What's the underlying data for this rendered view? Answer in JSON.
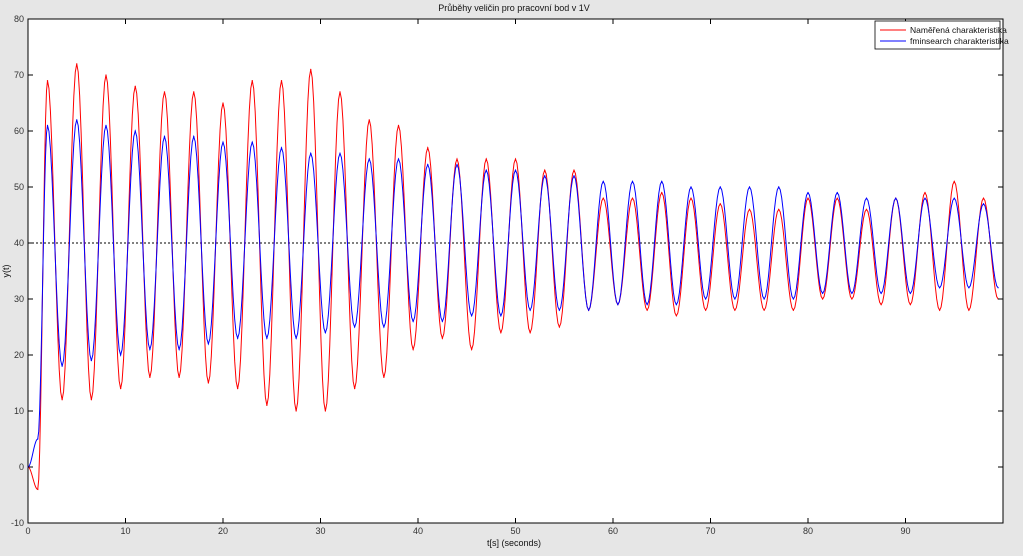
{
  "chart_data": {
    "type": "line",
    "title": "Průběhy veličin pro pracovní bod v 1V",
    "xlabel": "t[s] (seconds)",
    "ylabel": "y(t)",
    "xlim": [
      0,
      100
    ],
    "ylim": [
      -10,
      80
    ],
    "xticks": [
      0,
      10,
      20,
      30,
      40,
      50,
      60,
      70,
      80,
      90
    ],
    "yticks": [
      -10,
      0,
      10,
      20,
      30,
      40,
      50,
      60,
      70,
      80
    ],
    "grid": false,
    "legend_position": "top-right",
    "reference_line": {
      "y": 40,
      "style": "dotted",
      "color": "#000000"
    },
    "series": [
      {
        "name": "Naměřená charakteristika",
        "color": "#ff0000",
        "x": [
          0,
          1,
          2,
          3.5,
          5,
          6.5,
          8,
          9.5,
          11,
          12.5,
          14,
          15.5,
          17,
          18.5,
          20,
          21.5,
          23,
          24.5,
          26,
          27.5,
          29,
          30.5,
          32,
          33.5,
          35,
          36.5,
          38,
          39.5,
          41,
          42.5,
          44,
          45.5,
          47,
          48.5,
          50,
          51.5,
          53,
          54.5,
          56,
          57.5,
          59,
          60.5,
          62,
          63.5,
          65,
          66.5,
          68,
          69.5,
          71,
          72.5,
          74,
          75.5,
          77,
          78.5,
          80,
          81.5,
          83,
          84.5,
          86,
          87.5,
          89,
          90.5,
          92,
          93.5,
          95,
          96.5,
          98,
          99.5
        ],
        "y": [
          0,
          -4,
          69,
          12,
          72,
          12,
          70,
          14,
          68,
          16,
          67,
          16,
          67,
          15,
          65,
          14,
          69,
          11,
          69,
          10,
          71,
          10,
          67,
          14,
          62,
          16,
          61,
          21,
          57,
          23,
          55,
          21,
          55,
          24,
          55,
          24,
          53,
          25,
          53,
          28,
          48,
          29,
          48,
          28,
          49,
          27,
          48,
          28,
          47,
          28,
          46,
          28,
          46,
          28,
          48,
          30,
          48,
          30,
          46,
          29,
          48,
          29,
          49,
          28,
          51,
          28,
          48,
          30
        ]
      },
      {
        "name": "fminsearch charakteristika",
        "color": "#0000ff",
        "x": [
          0,
          1,
          2,
          3.5,
          5,
          6.5,
          8,
          9.5,
          11,
          12.5,
          14,
          15.5,
          17,
          18.5,
          20,
          21.5,
          23,
          24.5,
          26,
          27.5,
          29,
          30.5,
          32,
          33.5,
          35,
          36.5,
          38,
          39.5,
          41,
          42.5,
          44,
          45.5,
          47,
          48.5,
          50,
          51.5,
          53,
          54.5,
          56,
          57.5,
          59,
          60.5,
          62,
          63.5,
          65,
          66.5,
          68,
          69.5,
          71,
          72.5,
          74,
          75.5,
          77,
          78.5,
          80,
          81.5,
          83,
          84.5,
          86,
          87.5,
          89,
          90.5,
          92,
          93.5,
          95,
          96.5,
          98,
          99.5
        ],
        "y": [
          0,
          5,
          61,
          18,
          62,
          19,
          61,
          20,
          60,
          21,
          59,
          21,
          59,
          22,
          58,
          23,
          58,
          23,
          57,
          23,
          56,
          24,
          56,
          25,
          55,
          25,
          55,
          26,
          54,
          26,
          54,
          27,
          53,
          27,
          53,
          28,
          52,
          28,
          52,
          28,
          51,
          29,
          51,
          29,
          51,
          29,
          50,
          30,
          50,
          30,
          50,
          30,
          50,
          30,
          49,
          31,
          49,
          31,
          48,
          31,
          48,
          31,
          48,
          32,
          48,
          32,
          47,
          32
        ]
      }
    ]
  }
}
